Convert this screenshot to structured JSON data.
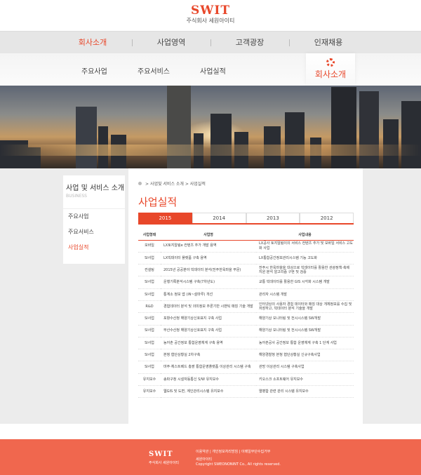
{
  "header": {
    "logo": "SWIT",
    "logo_sub": "주식회사 세원아이티"
  },
  "gnb": [
    "회사소개",
    "사업영역",
    "고객광장",
    "인재채용"
  ],
  "subnav": {
    "items": [
      "주요사업",
      "주요서비스",
      "사업실적"
    ],
    "section": "회사소개"
  },
  "lnb": {
    "title": "사업 및 서비스 소개",
    "title_en": "BUSINESS",
    "items": [
      "주요사업",
      "주요서비스",
      "사업실적"
    ]
  },
  "breadcrumb": [
    "사업및 서비스 소개",
    "사업실적"
  ],
  "page_title": "사업실적",
  "tabs": [
    "2015",
    "2014",
    "2013",
    "2012"
  ],
  "table": {
    "headers": [
      "사업형태",
      "사업명",
      "사업내용"
    ],
    "rows": [
      [
        "모바일",
        "LX토지알림e 컨텐츠 추가 개발 용역",
        "LX공사 토지알림이의 서비스 컨텐츠 추가 및 모바일 서비스 고도화 사업"
      ],
      [
        "SI사업",
        "LX빅데이터 플랫폼 구축 용역",
        "LX통합공간정보관리시스템 기능 고도화"
      ],
      [
        "컨설팅",
        "2015년 공공분야 빅데이터 분석(전주한옥마을 부문)",
        "전주시 한옥마을을 대상으로 빅데이터를 활용한 관광정책·축제 지원 분석 알고리즘 구현 및 검증"
      ],
      [
        "SI사업",
        "운행기록분석시스템 구축(7차년도)",
        "교통 빅데이터를 활용한 GIS 시각화 시스템 개발"
      ],
      [
        "SI사업",
        "통계소 정보 앱 (iN~설마루) 개선",
        "관리자 시스템 개발"
      ],
      [
        "R&D",
        "경험데이터 분석 및 의미정보 추론기반 시맨틱 매칭 기술 개발",
        "인터넷상의 사용자 경험 데이터와 매칭 대상 개체정보를 수집 및 저장하고, 빅데이터 분석 기술을 개발"
      ],
      [
        "SI사업",
        "포항수산청 해양기상신호표지 구축 사업",
        "해양기상 모니터링 및 전시시스템 SW개발"
      ],
      [
        "SI사업",
        "부산수산청 해양기상신호표지 구축 사업",
        "해양기상 모니터링 및 전시시스템 SW개발"
      ],
      [
        "SI사업",
        "농어촌 공간정보 통합운영체계 구축 용역",
        "농어촌공사 공간정보 통합 운영체계 구축 1 단계 사업"
      ],
      [
        "SI사업",
        "본청 협단상황실 2차구축",
        "해양경찰청 본청 협단상황실 신규구축사업"
      ],
      [
        "SI사업",
        "마주·체스트베드 총괄 통합운영플랫폼 이상관리 시스템 구축",
        "관망 이상관리 시스템 구축사업"
      ],
      [
        "유지보수",
        "송파구청 시설자동통신 S/W 유지보수",
        "키오스크 소프트웨어 유지보수"
      ],
      [
        "유지보수",
        "웹GIS 및 도면, 계인관리시스템 유지보수",
        "열병합 관련 관리 시스템 유지보수"
      ]
    ]
  },
  "footer": {
    "logo": "SWIT",
    "sub": "주식회사 세원아이티",
    "links": "이용약관  |  개인정보처리방침  |  이메일무단수집거부",
    "name": "세원아이티",
    "copyright": "Copyright SWEONONINT Co., All rights reserved."
  },
  "colors": {
    "accent": "#e8472a",
    "footer": "#f0674e"
  }
}
